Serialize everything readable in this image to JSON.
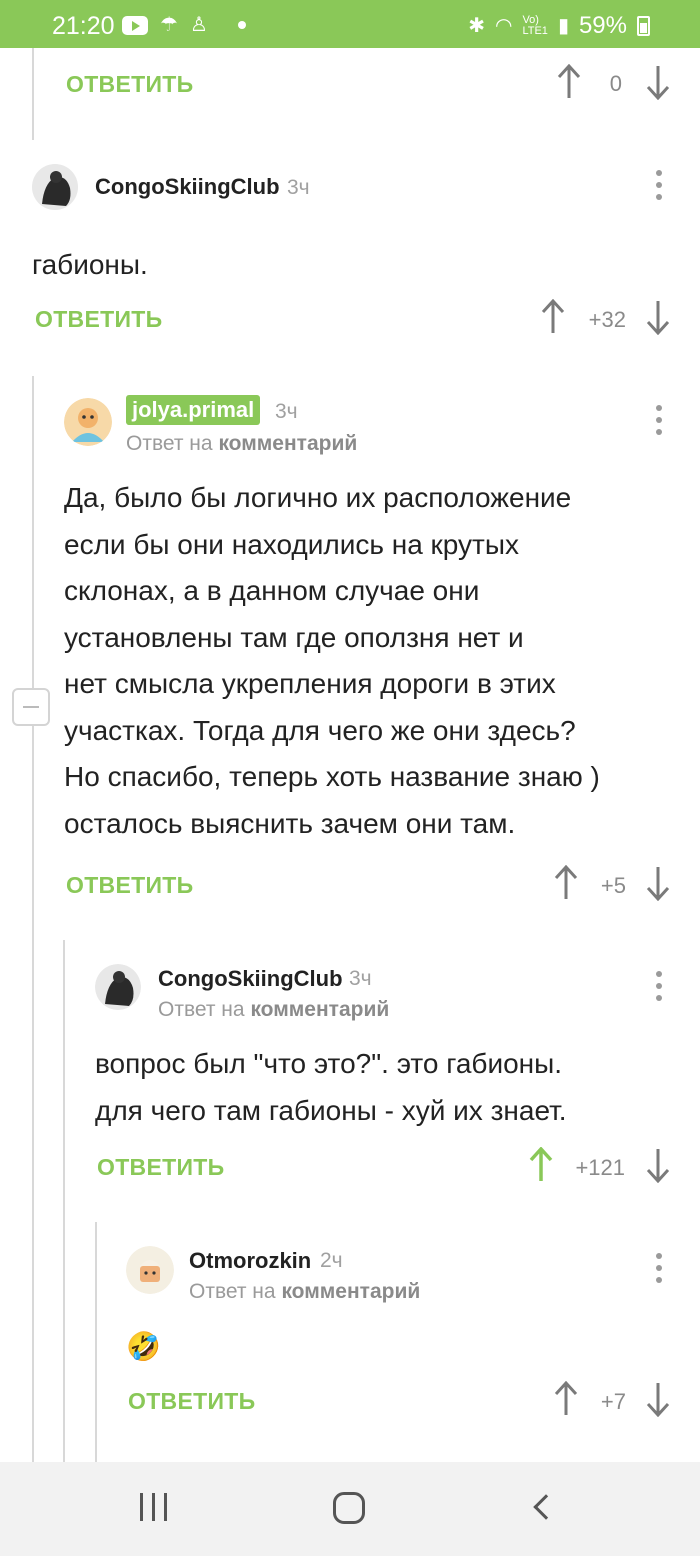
{
  "status_bar": {
    "time": "21:20",
    "battery": "59%"
  },
  "top_comment": {
    "reply_label": "ОТВЕТИТЬ",
    "score": "0"
  },
  "comments": [
    {
      "user": "CongoSkiingClub",
      "time": "3ч",
      "text": "габионы.",
      "reply_label": "ОТВЕТИТЬ",
      "score": "+32"
    },
    {
      "user": "jolya.primal",
      "time": "3ч",
      "reply_to_prefix": "Ответ на",
      "reply_to_target": "комментарий",
      "text_lines": [
        "Да, было бы логично их расположение",
        "если бы они находились на крутых",
        "склонах, а в данном случае они",
        "установлены там где оползня нет и",
        "нет смысла укрепления дороги в этих",
        "участках. Тогда для чего же они здесь?",
        "Но спасибо, теперь хоть название знаю )",
        "осталось выяснить зачем они там."
      ],
      "reply_label": "ОТВЕТИТЬ",
      "score": "+5"
    },
    {
      "user": "CongoSkiingClub",
      "time": "3ч",
      "reply_to_prefix": "Ответ на",
      "reply_to_target": "комментарий",
      "text_lines": [
        "вопрос был \"что это?\". это габионы.",
        "для чего там габионы - хуй их знает."
      ],
      "reply_label": "ОТВЕТИТЬ",
      "score": "+121",
      "upvoted": true
    },
    {
      "user": "Otmorozkin",
      "time": "2ч",
      "reply_to_prefix": "Ответ на",
      "reply_to_target": "комментарий",
      "text": "🤣",
      "reply_label": "ОТВЕТИТЬ",
      "score": "+7"
    }
  ],
  "colors": {
    "accent": "#8ac858",
    "arrow": "#7a7a7a",
    "arrow_active": "#8ac858"
  },
  "icons": {
    "nav_recent": "recent-apps-icon",
    "nav_home": "home-icon",
    "nav_back": "back-icon"
  }
}
